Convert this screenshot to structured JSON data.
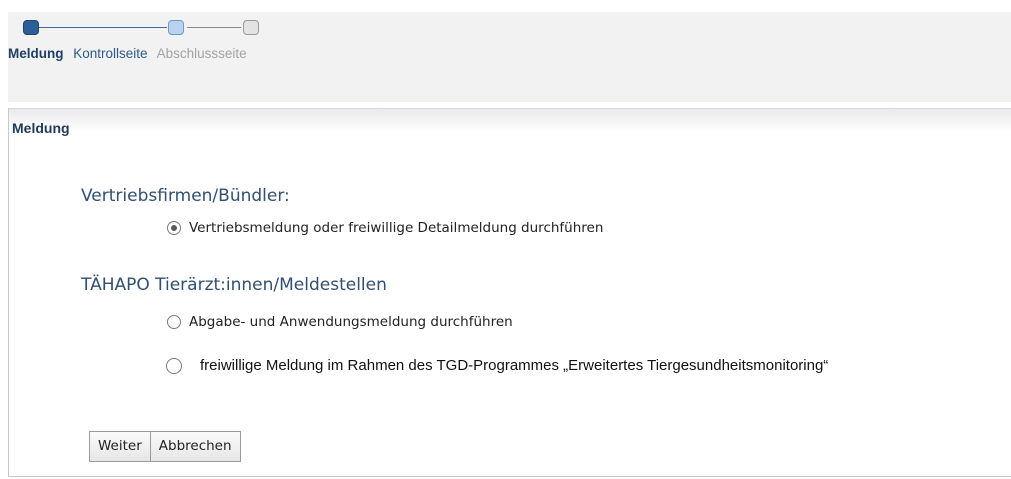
{
  "wizard": {
    "steps": [
      {
        "label": "Meldung",
        "state": "active"
      },
      {
        "label": "Kontrollseite",
        "state": "next"
      },
      {
        "label": "Abschlussseite",
        "state": "disabled"
      }
    ]
  },
  "panel": {
    "title": "Meldung",
    "sections": [
      {
        "heading": "Vertriebsfirmen/Bündler:",
        "options": [
          {
            "label": "Vertriebsmeldung oder freiwillige Detailmeldung durchführen",
            "checked": true
          }
        ]
      },
      {
        "heading": "TÄHAPO Tierärzt:innen/Meldestellen",
        "options": [
          {
            "label": "Abgabe- und Anwendungsmeldung durchführen",
            "checked": false
          },
          {
            "label": "freiwillige Meldung im Rahmen des TGD-Programmes „Erweitertes Tiergesundheitsmonitoring“",
            "checked": false
          }
        ]
      }
    ],
    "buttons": {
      "next_label": "Weiter",
      "cancel_label": "Abbrechen"
    }
  },
  "colors": {
    "accent": "#2c5f96",
    "heading": "#2f4f73",
    "panel_title": "#1f3b5c",
    "disabled": "#a3a3a3"
  }
}
